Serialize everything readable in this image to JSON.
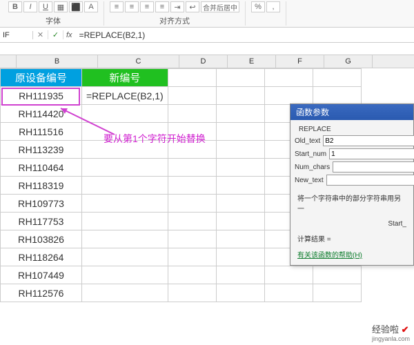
{
  "ribbon": {
    "font_group": "字体",
    "align_group": "对齐方式",
    "merge_label": "合并后居中"
  },
  "formula_bar": {
    "name_box": "IF",
    "cancel": "✕",
    "confirm": "✓",
    "fx": "fx",
    "formula": "=REPLACE(B2,1)"
  },
  "columns": [
    "B",
    "C",
    "D",
    "E",
    "F",
    "G"
  ],
  "headers": {
    "b": "原设备编号",
    "c": "新编号"
  },
  "rows": [
    {
      "b": "RH111935",
      "c": "=REPLACE(B2,1)"
    },
    {
      "b": "RH114420",
      "c": ""
    },
    {
      "b": "RH111516",
      "c": ""
    },
    {
      "b": "RH113239",
      "c": ""
    },
    {
      "b": "RH110464",
      "c": ""
    },
    {
      "b": "RH118319",
      "c": ""
    },
    {
      "b": "RH109773",
      "c": ""
    },
    {
      "b": "RH117753",
      "c": ""
    },
    {
      "b": "RH103826",
      "c": ""
    },
    {
      "b": "RH118264",
      "c": ""
    },
    {
      "b": "RH107449",
      "c": ""
    },
    {
      "b": "RH112576",
      "c": ""
    }
  ],
  "annotation": "要从第1个字符开始替换",
  "dialog": {
    "title": "函数参数",
    "func": "REPLACE",
    "fields": {
      "old_text": {
        "label": "Old_text",
        "value": "B2"
      },
      "start_num": {
        "label": "Start_num",
        "value": "1"
      },
      "num_chars": {
        "label": "Num_chars",
        "value": ""
      },
      "new_text": {
        "label": "New_text",
        "value": ""
      }
    },
    "desc1": "将一个字符串中的部分字符串用另一",
    "desc2": "Start_",
    "result_label": "计算结果 =",
    "help_link": "有关该函数的帮助(H)"
  },
  "watermark": {
    "text": "经验啦",
    "domain": "jingyanla.com"
  }
}
